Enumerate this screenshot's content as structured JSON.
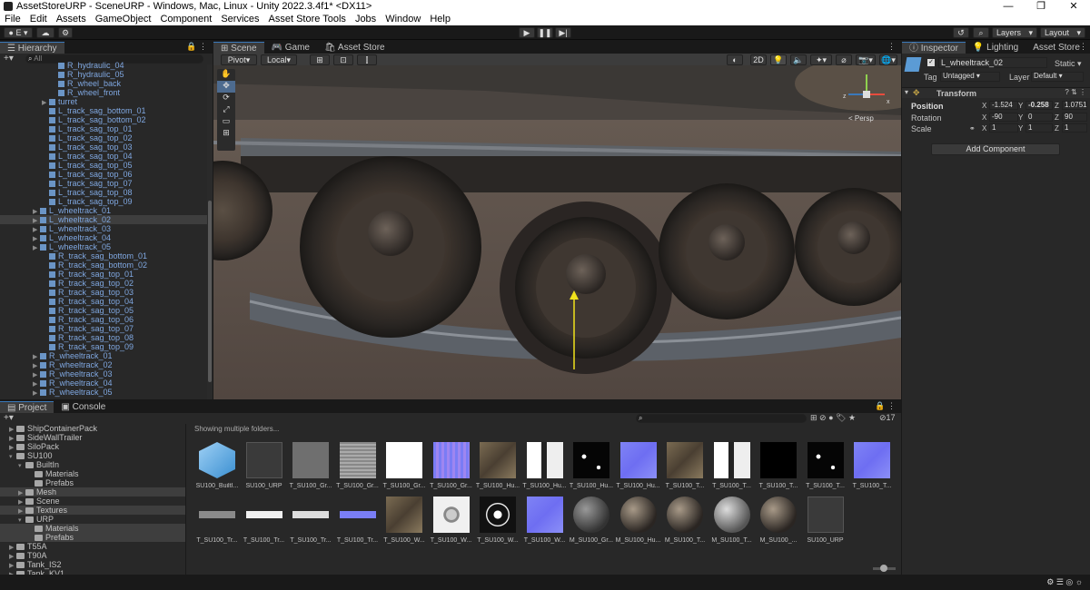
{
  "window": {
    "title": "AssetStoreURP - SceneURP - Windows, Mac, Linux - Unity 2022.3.4f1* <DX11>",
    "controls": [
      "—",
      "❐",
      "✕"
    ]
  },
  "menu": [
    "File",
    "Edit",
    "Assets",
    "GameObject",
    "Component",
    "Services",
    "Asset Store Tools",
    "Jobs",
    "Window",
    "Help"
  ],
  "toolbar": {
    "account_label": "E",
    "layers_label": "Layers",
    "layout_label": "Layout"
  },
  "hierarchy": {
    "tab": "Hierarchy",
    "search_placeholder": "All",
    "rows": [
      {
        "label": "R_hydraulic_04",
        "indent": 5,
        "arrow": false
      },
      {
        "label": "R_hydraulic_05",
        "indent": 5,
        "arrow": false
      },
      {
        "label": "R_wheel_back",
        "indent": 5,
        "arrow": false
      },
      {
        "label": "R_wheel_front",
        "indent": 5,
        "arrow": false
      },
      {
        "label": "turret",
        "indent": 4,
        "arrow": true
      },
      {
        "label": "L_track_sag_bottom_01",
        "indent": 4,
        "arrow": false
      },
      {
        "label": "L_track_sag_bottom_02",
        "indent": 4,
        "arrow": false
      },
      {
        "label": "L_track_sag_top_01",
        "indent": 4,
        "arrow": false
      },
      {
        "label": "L_track_sag_top_02",
        "indent": 4,
        "arrow": false
      },
      {
        "label": "L_track_sag_top_03",
        "indent": 4,
        "arrow": false
      },
      {
        "label": "L_track_sag_top_04",
        "indent": 4,
        "arrow": false
      },
      {
        "label": "L_track_sag_top_05",
        "indent": 4,
        "arrow": false
      },
      {
        "label": "L_track_sag_top_06",
        "indent": 4,
        "arrow": false
      },
      {
        "label": "L_track_sag_top_07",
        "indent": 4,
        "arrow": false
      },
      {
        "label": "L_track_sag_top_08",
        "indent": 4,
        "arrow": false
      },
      {
        "label": "L_track_sag_top_09",
        "indent": 4,
        "arrow": false
      },
      {
        "label": "L_wheeltrack_01",
        "indent": 3,
        "arrow": true
      },
      {
        "label": "L_wheeltrack_02",
        "indent": 3,
        "arrow": true,
        "selected": true
      },
      {
        "label": "L_wheeltrack_03",
        "indent": 3,
        "arrow": true
      },
      {
        "label": "L_wheeltrack_04",
        "indent": 3,
        "arrow": true
      },
      {
        "label": "L_wheeltrack_05",
        "indent": 3,
        "arrow": true
      },
      {
        "label": "R_track_sag_bottom_01",
        "indent": 4,
        "arrow": false
      },
      {
        "label": "R_track_sag_bottom_02",
        "indent": 4,
        "arrow": false
      },
      {
        "label": "R_track_sag_top_01",
        "indent": 4,
        "arrow": false
      },
      {
        "label": "R_track_sag_top_02",
        "indent": 4,
        "arrow": false
      },
      {
        "label": "R_track_sag_top_03",
        "indent": 4,
        "arrow": false
      },
      {
        "label": "R_track_sag_top_04",
        "indent": 4,
        "arrow": false
      },
      {
        "label": "R_track_sag_top_05",
        "indent": 4,
        "arrow": false
      },
      {
        "label": "R_track_sag_top_06",
        "indent": 4,
        "arrow": false
      },
      {
        "label": "R_track_sag_top_07",
        "indent": 4,
        "arrow": false
      },
      {
        "label": "R_track_sag_top_08",
        "indent": 4,
        "arrow": false
      },
      {
        "label": "R_track_sag_top_09",
        "indent": 4,
        "arrow": false
      },
      {
        "label": "R_wheeltrack_01",
        "indent": 3,
        "arrow": true
      },
      {
        "label": "R_wheeltrack_02",
        "indent": 3,
        "arrow": true
      },
      {
        "label": "R_wheeltrack_03",
        "indent": 3,
        "arrow": true
      },
      {
        "label": "R_wheeltrack_04",
        "indent": 3,
        "arrow": true
      },
      {
        "label": "R_wheeltrack_05",
        "indent": 3,
        "arrow": true
      }
    ]
  },
  "scene": {
    "tabs": [
      "Scene",
      "Game",
      "Asset Store"
    ],
    "pivot_label": "Pivot",
    "local_label": "Local",
    "mode_2d": "2D",
    "persp_label": "< Persp"
  },
  "inspector": {
    "tabs": [
      "Inspector",
      "Lighting",
      "Asset Store Uplo"
    ],
    "object_name": "L_wheeltrack_02",
    "static_label": "Static",
    "tag_label": "Tag",
    "tag_value": "Untagged",
    "layer_label": "Layer",
    "layer_value": "Default",
    "component_title": "Transform",
    "position_label": "Position",
    "rotation_label": "Rotation",
    "scale_label": "Scale",
    "position": {
      "x": "-1.524",
      "y": "-0.258",
      "z": "1.0751"
    },
    "rotation": {
      "x": "-90",
      "y": "0",
      "z": "90"
    },
    "scale": {
      "x": "1",
      "y": "1",
      "z": "1"
    },
    "add_component": "Add Component"
  },
  "project": {
    "tabs": [
      "Project",
      "Console"
    ],
    "showing": "Showing multiple folders...",
    "hidden_count": "17",
    "folders": [
      {
        "label": "ShipContainerPack",
        "indent": 1
      },
      {
        "label": "SideWallTrailer",
        "indent": 1
      },
      {
        "label": "SiloPack",
        "indent": 1
      },
      {
        "label": "SU100",
        "indent": 1,
        "open": true
      },
      {
        "label": "BuiltIn",
        "indent": 2,
        "open": true
      },
      {
        "label": "Materials",
        "indent": 3
      },
      {
        "label": "Prefabs",
        "indent": 3
      },
      {
        "label": "Mesh",
        "indent": 2,
        "sel": true
      },
      {
        "label": "Scene",
        "indent": 2
      },
      {
        "label": "Textures",
        "indent": 2,
        "sel": true
      },
      {
        "label": "URP",
        "indent": 2,
        "open": true
      },
      {
        "label": "Materials",
        "indent": 3,
        "sel": true
      },
      {
        "label": "Prefabs",
        "indent": 3,
        "sel": true
      },
      {
        "label": "T55A",
        "indent": 1
      },
      {
        "label": "T90A",
        "indent": 1
      },
      {
        "label": "Tank_IS2",
        "indent": 1
      },
      {
        "label": "Tank_KV1",
        "indent": 1
      }
    ],
    "assets_row1": [
      {
        "label": "SU100_BuiltI...",
        "kind": "prefab-cube"
      },
      {
        "label": "SU100_URP",
        "kind": "mesh"
      },
      {
        "label": "T_SU100_Gr...",
        "kind": "gray"
      },
      {
        "label": "T_SU100_Gr...",
        "kind": "grid"
      },
      {
        "label": "T_SU100_Gr...",
        "kind": "white"
      },
      {
        "label": "T_SU100_Gr...",
        "kind": "purple-grid"
      },
      {
        "label": "T_SU100_Hu...",
        "kind": "camo"
      },
      {
        "label": "T_SU100_Hu...",
        "kind": "bw"
      },
      {
        "label": "T_SU100_Hu...",
        "kind": "black-spots"
      },
      {
        "label": "T_SU100_Hu...",
        "kind": "normal"
      },
      {
        "label": "T_SU100_T...",
        "kind": "camo"
      },
      {
        "label": "T_SU100_T...",
        "kind": "bw"
      },
      {
        "label": "T_SU100_T...",
        "kind": "black"
      },
      {
        "label": "T_SU100_T...",
        "kind": "black-spots"
      },
      {
        "label": "T_SU100_T...",
        "kind": "normal"
      }
    ],
    "assets_row2": [
      {
        "label": "T_SU100_Tr...",
        "kind": "strip-gray"
      },
      {
        "label": "T_SU100_Tr...",
        "kind": "strip-white"
      },
      {
        "label": "T_SU100_Tr...",
        "kind": "strip-bw"
      },
      {
        "label": "T_SU100_Tr...",
        "kind": "strip-purple"
      },
      {
        "label": "T_SU100_W...",
        "kind": "camo"
      },
      {
        "label": "T_SU100_W...",
        "kind": "wheel-white"
      },
      {
        "label": "T_SU100_W...",
        "kind": "wheel-black"
      },
      {
        "label": "T_SU100_W...",
        "kind": "normal"
      },
      {
        "label": "M_SU100_Gr...",
        "kind": "sphere-grid"
      },
      {
        "label": "M_SU100_Hu...",
        "kind": "sphere"
      },
      {
        "label": "M_SU100_T...",
        "kind": "sphere"
      },
      {
        "label": "M_SU100_T...",
        "kind": "sphere-glass"
      },
      {
        "label": "M_SU100_...",
        "kind": "sphere"
      },
      {
        "label": "SU100_URP",
        "kind": "tank-mesh"
      }
    ]
  },
  "colors": {
    "accent": "#3a79bb",
    "hierarchy_text": "#7fa7e0",
    "gizmo_y": "#f0e21c"
  }
}
